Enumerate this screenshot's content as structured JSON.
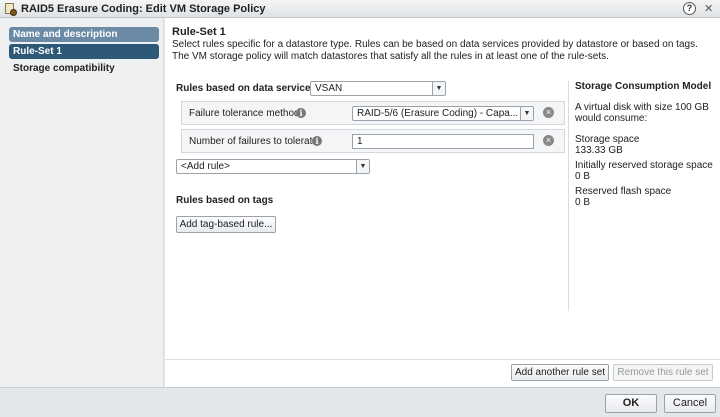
{
  "window": {
    "title": "RAID5 Erasure Coding: Edit VM Storage Policy",
    "help_label": "?",
    "close_label": "×"
  },
  "sidebar": {
    "items": [
      {
        "label": "Name and description",
        "state": "visited"
      },
      {
        "label": "Rule-Set 1",
        "state": "active"
      },
      {
        "label": "Storage compatibility",
        "state": "normal"
      }
    ]
  },
  "main": {
    "heading": "Rule-Set 1",
    "description_line1": "Select rules specific for a datastore type. Rules can be based on data services provided by datastore or based on tags.",
    "description_line2": "The VM storage policy will match datastores that satisfy all the rules in at least one of the rule-sets.",
    "data_services_label": "Rules based on data services",
    "data_services_value": "VSAN",
    "rules": [
      {
        "name": "Failure tolerance method",
        "value": "RAID-5/6 (Erasure Coding) - Capa..."
      },
      {
        "name": "Number of failures to tolerate",
        "value": "1"
      }
    ],
    "add_rule_value": "<Add rule>",
    "tags_label": "Rules based on tags",
    "add_tag_button": "Add tag-based rule...",
    "add_ruleset_button": "Add another rule set",
    "remove_ruleset_button": "Remove this rule set"
  },
  "consumption": {
    "title": "Storage Consumption Model",
    "intro_line1": "A virtual disk with size 100 GB",
    "intro_line2": "would consume:",
    "storage_space_label": "Storage space",
    "storage_space_value": "133.33 GB",
    "reserved_storage_label": "Initially reserved storage space",
    "reserved_storage_value": "0 B",
    "reserved_flash_label": "Reserved flash space",
    "reserved_flash_value": "0 B"
  },
  "footer": {
    "ok_label": "OK",
    "cancel_label": "Cancel"
  },
  "colors": {
    "nav_active": "#2e5878",
    "nav_visited": "#6b8aa6"
  }
}
